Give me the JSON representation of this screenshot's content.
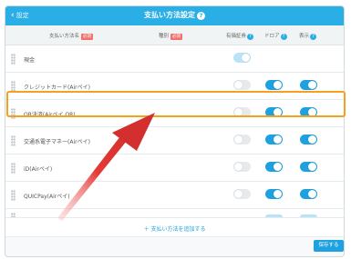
{
  "topbar": {
    "back_label": "設定",
    "title": "支払い方法設定"
  },
  "header": {
    "name_col": "支払い方法名",
    "type_col": "種別",
    "required_badge": "必須",
    "receipt_col": "有価証券",
    "drawer_col": "ドロア",
    "display_col": "表示"
  },
  "rows": [
    {
      "label": "現金",
      "receipt": "pale-on",
      "drawer": "none",
      "display": "none"
    },
    {
      "label": "クレジットカード(Airペイ)",
      "receipt": "off",
      "drawer": "on",
      "display": "on"
    },
    {
      "label": "QR決済(Airペイ QR)",
      "receipt": "off",
      "drawer": "on",
      "display": "on"
    },
    {
      "label": "交通系電子マネー(Airペイ)",
      "receipt": "off",
      "drawer": "on",
      "display": "on"
    },
    {
      "label": "iD(Airペイ)",
      "receipt": "off",
      "drawer": "on",
      "display": "on"
    },
    {
      "label": "QUICPay(Airペイ)",
      "receipt": "off",
      "drawer": "on",
      "display": "on"
    }
  ],
  "add_label": "＋ 支払い方法を追加する",
  "save_label": "保存する",
  "colors": {
    "accent": "#1da1e0",
    "highlight": "#f5a01f",
    "arrow": "#e53935"
  }
}
